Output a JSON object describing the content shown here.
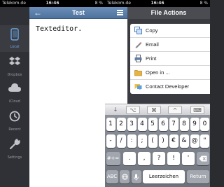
{
  "status_left": {
    "carrier": "Telekom.de",
    "time": "16:46",
    "right": "8 %"
  },
  "status_right": {
    "carrier": "Telekom.de",
    "time": "16:46",
    "right": "8 %"
  },
  "sidebar": {
    "items": [
      {
        "label": "Local",
        "icon": "phone-icon"
      },
      {
        "label": "Dropbox",
        "icon": "dropbox-icon"
      },
      {
        "label": "iCloud",
        "icon": "cloud-icon"
      },
      {
        "label": "Recent",
        "icon": "clock-icon"
      },
      {
        "label": "Settings",
        "icon": "wrench-icon"
      }
    ]
  },
  "editor": {
    "title": "Test",
    "back_glyph": "←",
    "content": "Texteditor."
  },
  "file_actions": {
    "title": "File Actions",
    "items": [
      {
        "label": "Copy",
        "icon": "copy-icon"
      },
      {
        "label": "Email",
        "icon": "email-icon"
      },
      {
        "label": "Print",
        "icon": "print-icon"
      },
      {
        "label": "Open in ...",
        "icon": "open-in-icon"
      },
      {
        "label": "Contact Developer",
        "icon": "contact-developer-icon"
      }
    ]
  },
  "accessory": {
    "buttons": [
      "↓",
      "⌥",
      "⌘",
      "^",
      "⌨"
    ]
  },
  "keyboard": {
    "row1": [
      "1",
      "2",
      "3",
      "4",
      "5",
      "6",
      "7",
      "8",
      "9",
      "0"
    ],
    "row2": [
      "-",
      "/",
      ":",
      ";",
      "(",
      ")",
      "€",
      "&",
      "@",
      "\""
    ],
    "row3_left": "#+=",
    "row3": [
      ".",
      ",",
      "?",
      "!",
      "'"
    ],
    "row4": {
      "abc": "ABC",
      "space": "Leerzeichen",
      "return": "Return"
    }
  }
}
